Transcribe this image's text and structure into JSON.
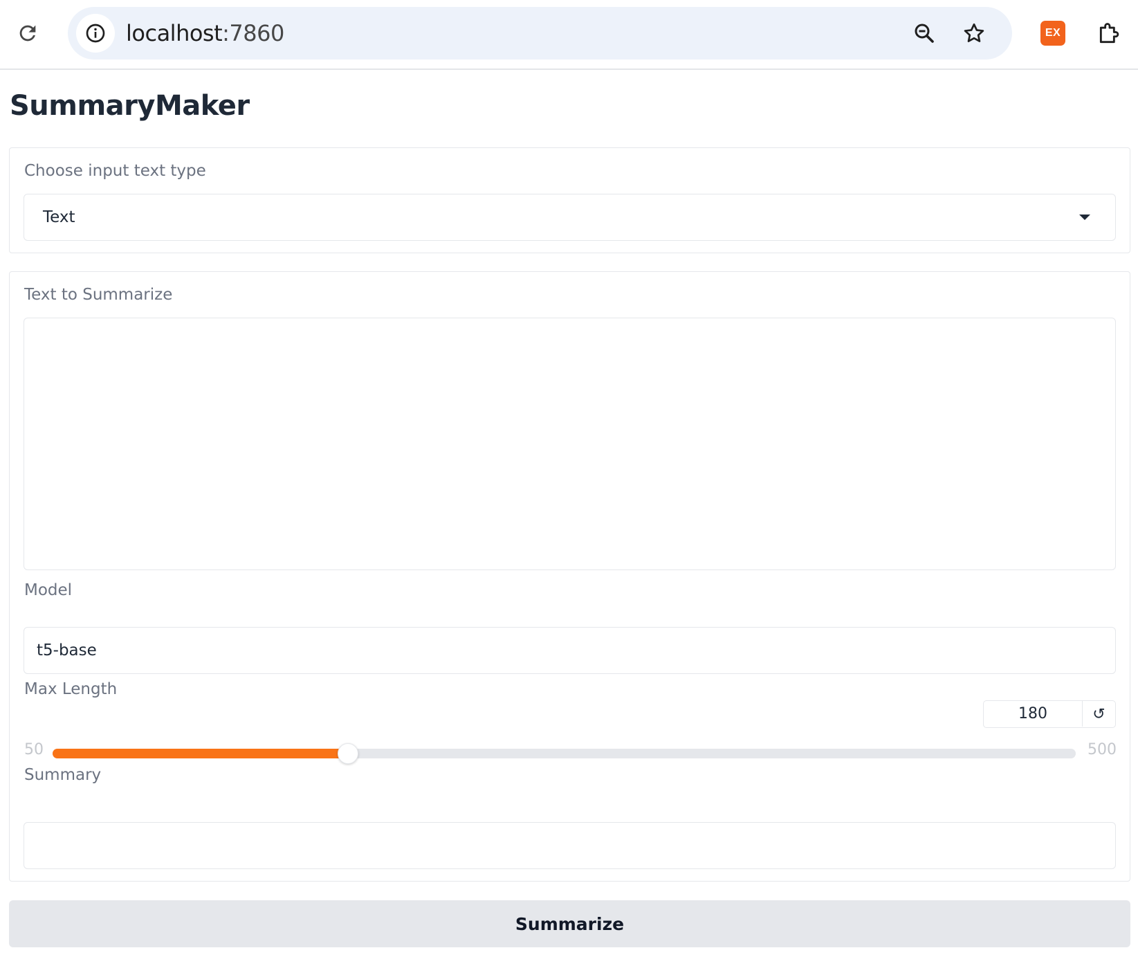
{
  "browser": {
    "url_host": "localhost",
    "url_port": ":7860",
    "extension_badge": "EX",
    "icons": [
      "reload-icon",
      "info-icon",
      "zoom-icon",
      "star-icon",
      "extension-badge-icon",
      "puzzle-icon"
    ],
    "accent": "#f2631c"
  },
  "app": {
    "title": "SummaryMaker"
  },
  "input_type": {
    "label": "Choose input text type",
    "selected": "Text"
  },
  "text_input": {
    "label": "Text to Summarize",
    "value": ""
  },
  "model": {
    "label": "Model",
    "value": "t5-base"
  },
  "max_length": {
    "label": "Max Length",
    "value": 180,
    "value_text": "180",
    "min": 50,
    "min_text": "50",
    "max": 500,
    "max_text": "500",
    "reset_glyph": "↺",
    "fill_color": "#f97316"
  },
  "summary": {
    "label": "Summary",
    "value": ""
  },
  "submit": {
    "label": "Summarize"
  }
}
